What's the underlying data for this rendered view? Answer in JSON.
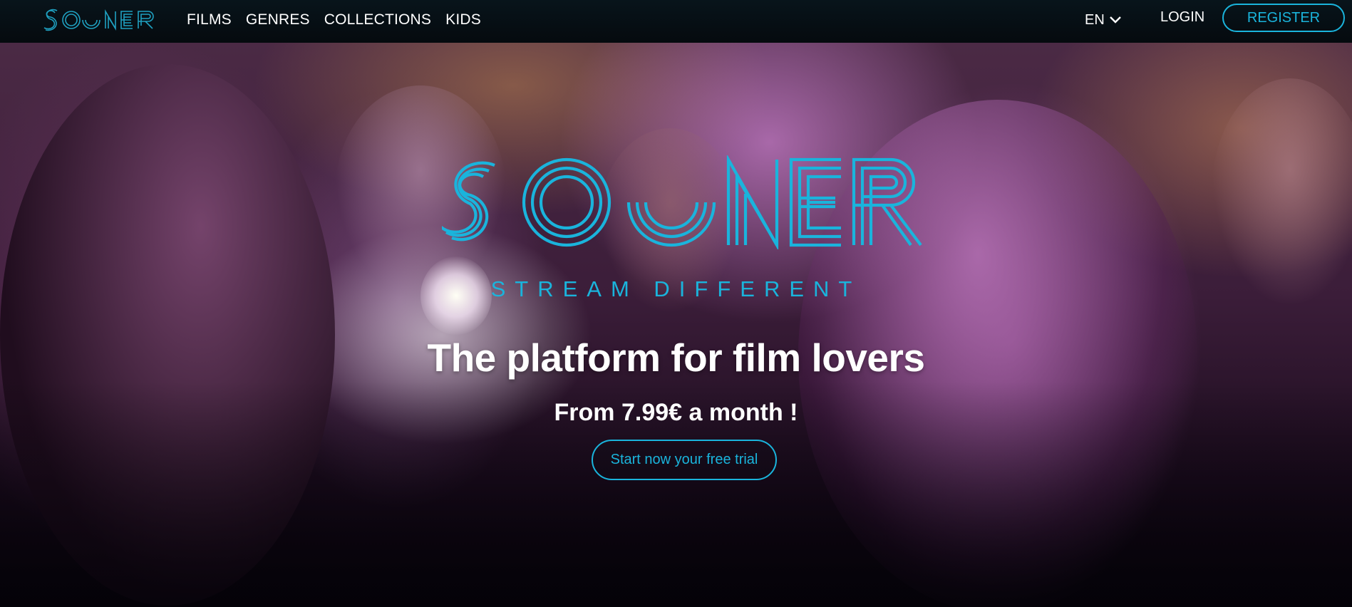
{
  "header": {
    "brand_name": "SOONER",
    "nav": [
      {
        "label": "FILMS"
      },
      {
        "label": "GENRES"
      },
      {
        "label": "COLLECTIONS"
      },
      {
        "label": "KIDS"
      }
    ],
    "language": "EN",
    "login_label": "LOGIN",
    "register_label": "REGISTER"
  },
  "hero": {
    "logo_text": "SOONER",
    "tagline": "STREAM DIFFERENT",
    "headline": "The platform for film lovers",
    "price": "From 7.99€ a month !",
    "cta_label": "Start now your free trial"
  },
  "colors": {
    "accent": "#1ab4dc",
    "header_bg": "#07121a",
    "text": "#ffffff"
  },
  "icons": {
    "language": "chevron-down-icon"
  }
}
